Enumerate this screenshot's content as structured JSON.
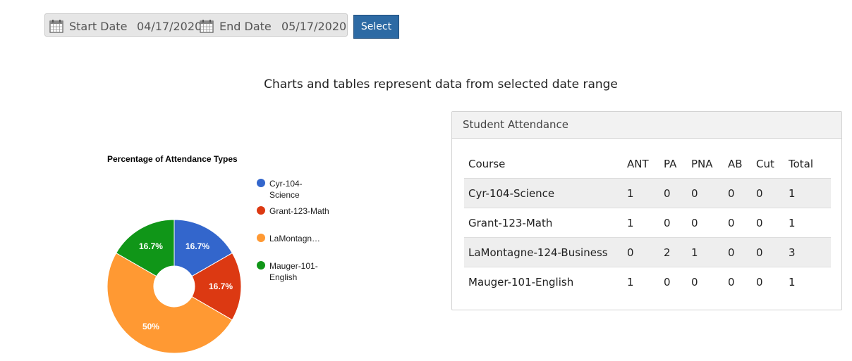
{
  "date_filter": {
    "start_label": "Start Date",
    "start_value": "04/17/2020",
    "end_label": "End Date",
    "end_value": "05/17/2020",
    "select_label": "Select"
  },
  "headline": "Charts and tables represent data from selected date range",
  "chart_data": {
    "type": "pie",
    "title": "Percentage of Attendance Types",
    "donut": true,
    "categories": [
      "Cyr-104-Science",
      "Grant-123-Math",
      "LaMontagne-124-Business",
      "Mauger-101-English"
    ],
    "legend_labels": [
      "Cyr-104-Science",
      "Grant-123-Math",
      "LaMontagn…",
      "Mauger-101-English"
    ],
    "values": [
      16.7,
      16.7,
      50,
      16.7
    ],
    "labels": [
      "16.7%",
      "16.7%",
      "50%",
      "16.7%"
    ],
    "colors": [
      "#3366cc",
      "#dc3912",
      "#ff9933",
      "#109618"
    ],
    "legend": "right"
  },
  "attendance": {
    "title": "Student Attendance",
    "columns": [
      "Course",
      "ANT",
      "PA",
      "PNA",
      "AB",
      "Cut",
      "Total"
    ],
    "rows": [
      [
        "Cyr-104-Science",
        "1",
        "0",
        "0",
        "0",
        "0",
        "1"
      ],
      [
        "Grant-123-Math",
        "1",
        "0",
        "0",
        "0",
        "0",
        "1"
      ],
      [
        "LaMontagne-124-Business",
        "0",
        "2",
        "1",
        "0",
        "0",
        "3"
      ],
      [
        "Mauger-101-English",
        "1",
        "0",
        "0",
        "0",
        "0",
        "1"
      ]
    ]
  },
  "icons": {
    "calendar": "calendar-icon"
  }
}
